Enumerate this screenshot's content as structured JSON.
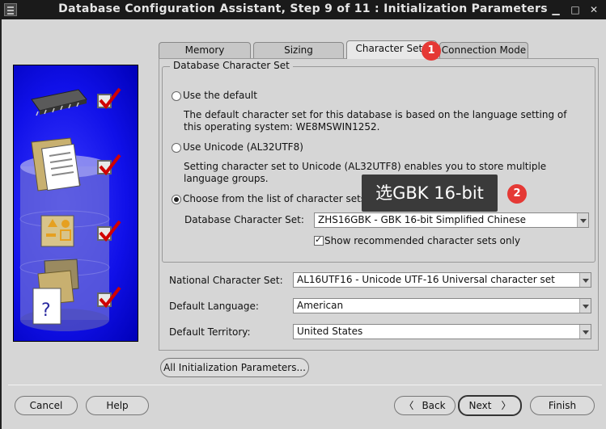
{
  "window": {
    "title": "Database Configuration Assistant, Step 9 of 11 : Initialization Parameters"
  },
  "tabs": [
    {
      "label": "Memory"
    },
    {
      "label": "Sizing"
    },
    {
      "label": "Character Sets"
    },
    {
      "label": "Connection Mode"
    }
  ],
  "group": {
    "legend": "Database Character Set",
    "option_default": {
      "label": "Use the default",
      "description": "The default character set for this database is based on the language setting of this operating system: WE8MSWIN1252."
    },
    "option_unicode": {
      "label": "Use Unicode (AL32UTF8)",
      "description": "Setting character set to Unicode (AL32UTF8) enables you to store multiple language groups."
    },
    "option_list": {
      "label": "Choose from the list of character sets",
      "field_label": "Database Character Set:",
      "value": "ZHS16GBK - GBK 16-bit Simplified Chinese",
      "checkbox_label": "Show recommended character sets only"
    }
  },
  "fields": {
    "national": {
      "label": "National Character Set:",
      "value": "AL16UTF16 - Unicode UTF-16 Universal character set"
    },
    "language": {
      "label": "Default Language:",
      "value": "American"
    },
    "territory": {
      "label": "Default Territory:",
      "value": "United States"
    }
  },
  "all_params_label": "All Initialization Parameters...",
  "buttons": {
    "cancel": "Cancel",
    "help": "Help",
    "back": "Back",
    "next": "Next",
    "finish": "Finish"
  },
  "annotations": {
    "tooltip": "选GBK 16-bit",
    "badge1": "1",
    "badge2": "2"
  },
  "colors": {
    "side_panel": "#1c1cff",
    "badge": "#e53935",
    "tooltip": "#3a3a3a"
  }
}
